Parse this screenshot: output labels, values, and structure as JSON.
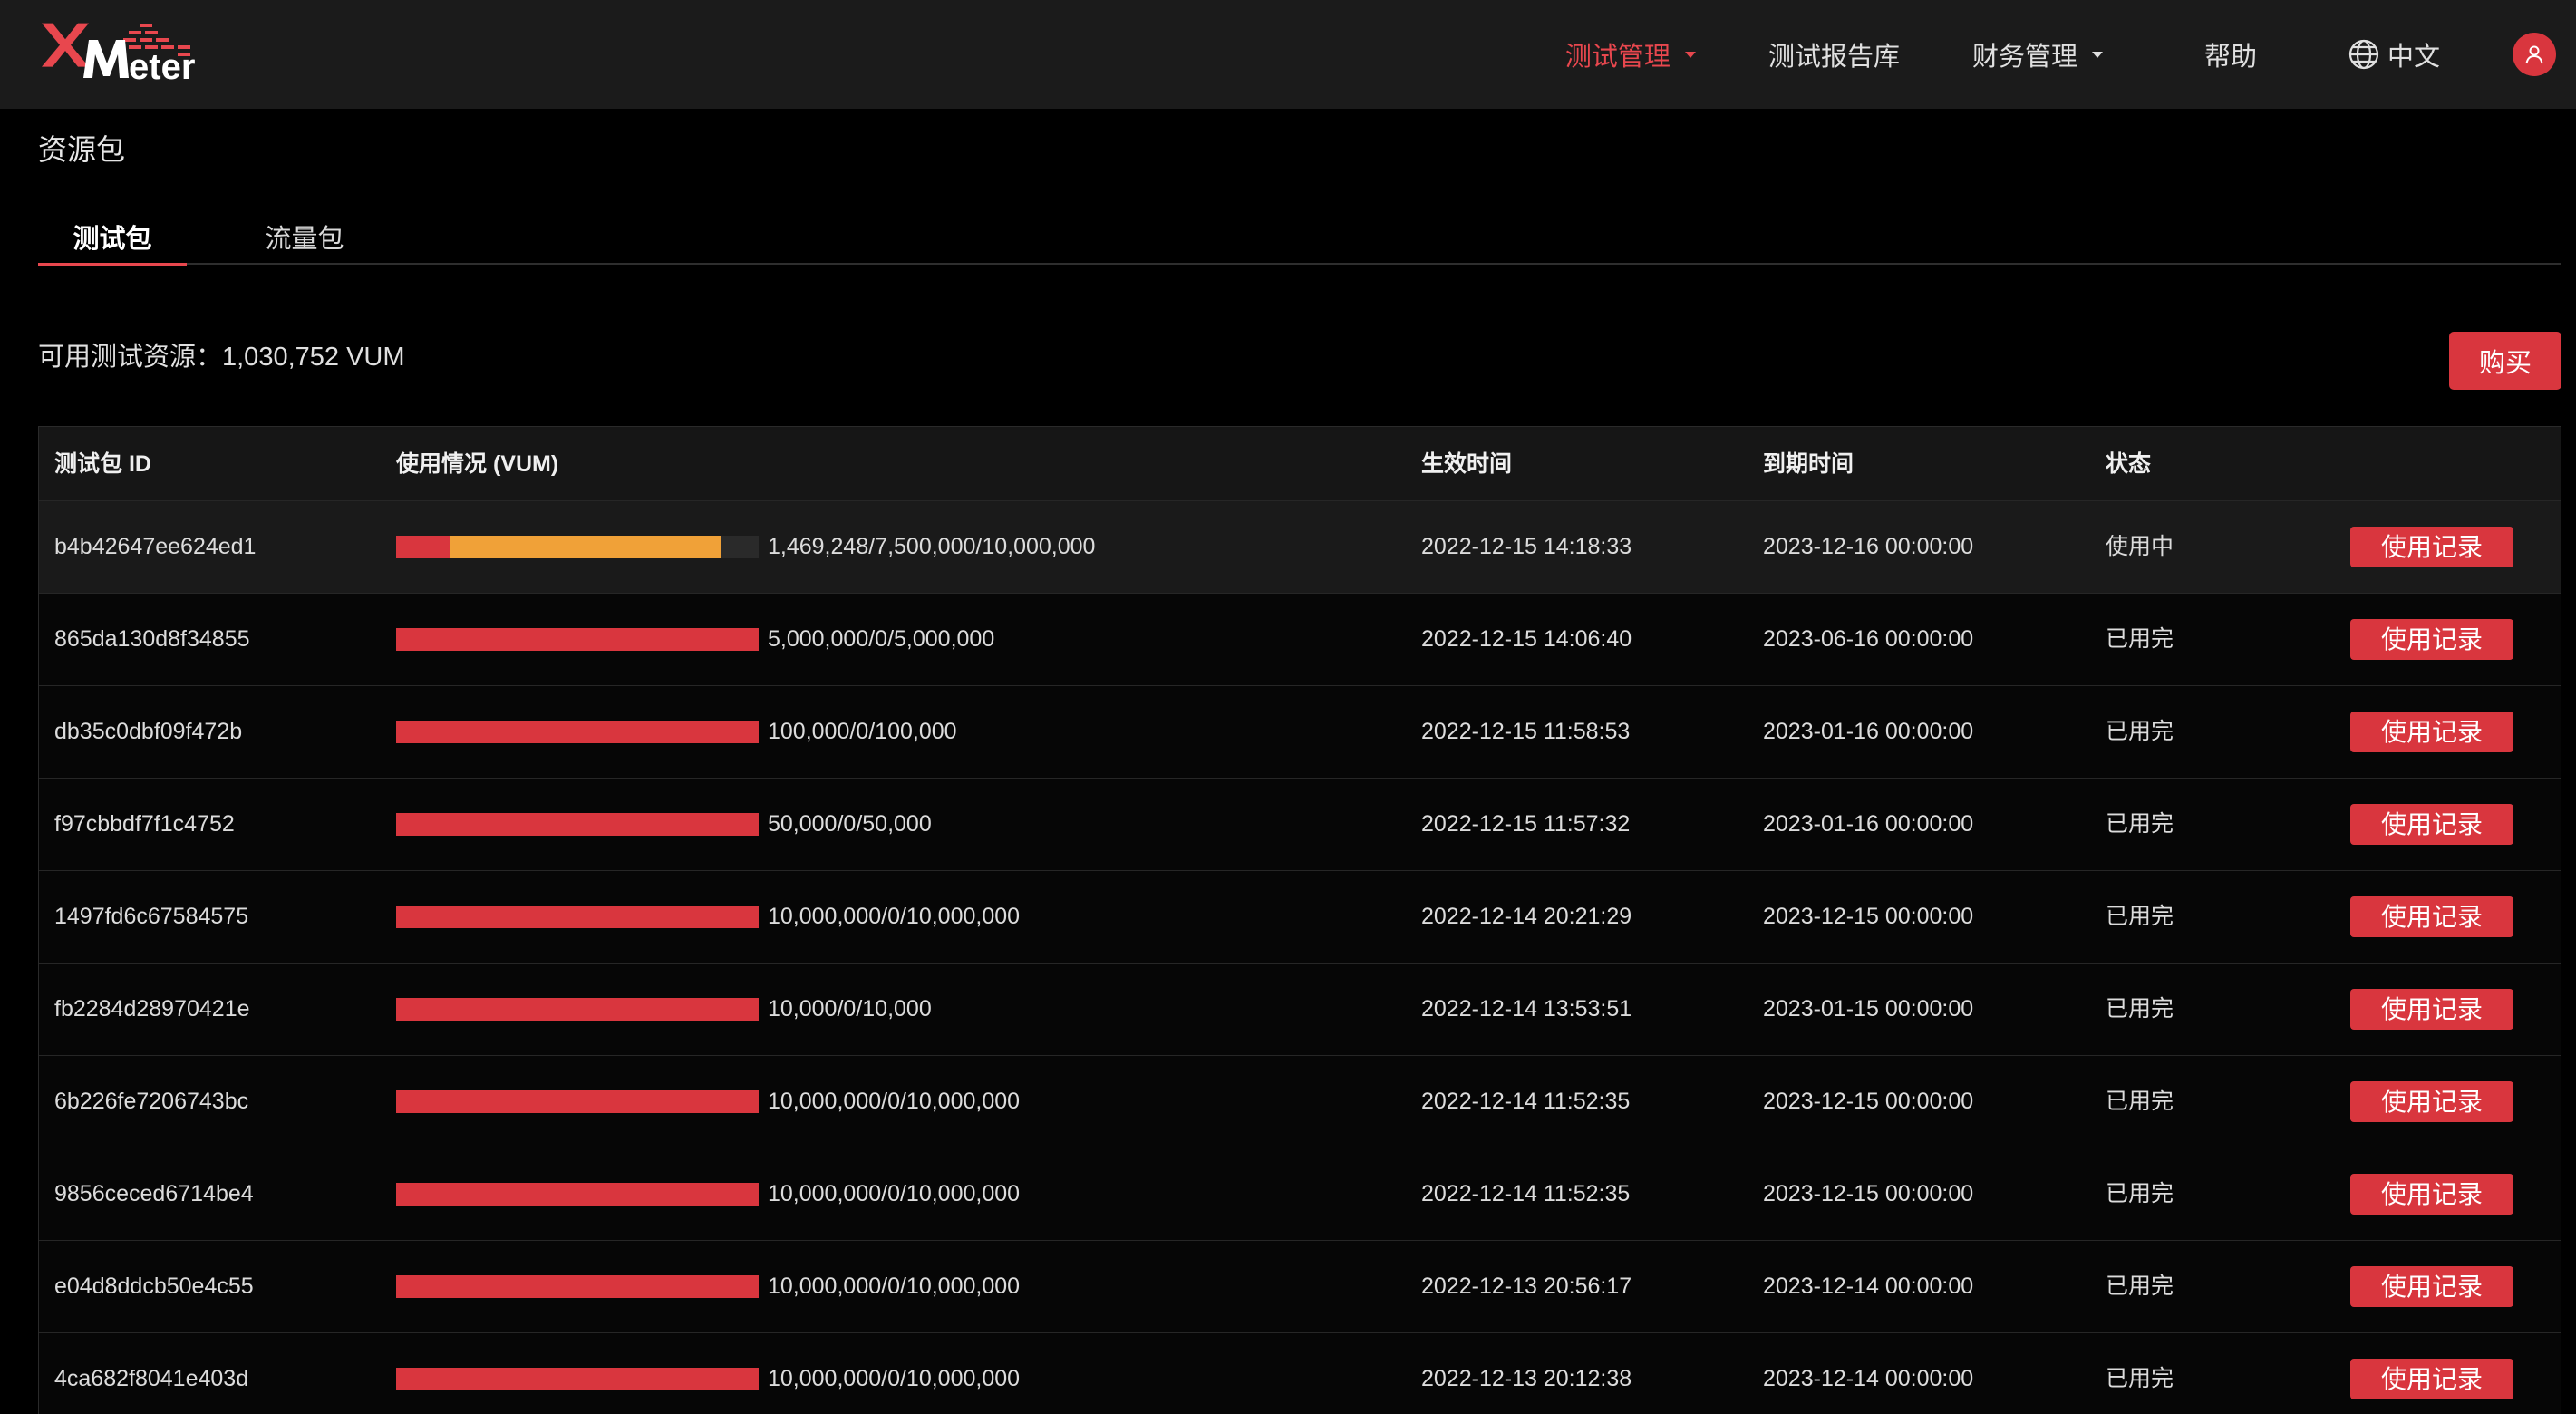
{
  "header": {
    "logo_text": "XMeter",
    "nav": [
      {
        "label": "测试管理",
        "active": true,
        "dropdown": true
      },
      {
        "label": "测试报告库",
        "active": false,
        "dropdown": false
      },
      {
        "label": "财务管理",
        "active": false,
        "dropdown": true
      },
      {
        "label": "帮助",
        "active": false,
        "dropdown": false
      }
    ],
    "language": "中文",
    "language_icon": "globe-icon",
    "avatar_icon": "user-icon"
  },
  "page": {
    "title": "资源包",
    "tabs": [
      {
        "label": "测试包",
        "active": true
      },
      {
        "label": "流量包",
        "active": false
      }
    ],
    "resource_label": "可用测试资源：1,030,752 VUM",
    "buy_label": "购买"
  },
  "table": {
    "columns": [
      "测试包 ID",
      "使用情况 (VUM)",
      "生效时间",
      "到期时间",
      "状态"
    ],
    "rows": [
      {
        "id": "b4b42647ee624ed1",
        "usage": "1,469,248/7,500,000/10,000,000",
        "used": 1469248,
        "available": 7500000,
        "total": 10000000,
        "start": "2022-12-15 14:18:33",
        "end": "2023-12-16 00:00:00",
        "status": "使用中",
        "action": "使用记录"
      },
      {
        "id": "865da130d8f34855",
        "usage": "5,000,000/0/5,000,000",
        "used": 5000000,
        "available": 0,
        "total": 5000000,
        "start": "2022-12-15 14:06:40",
        "end": "2023-06-16 00:00:00",
        "status": "已用完",
        "action": "使用记录"
      },
      {
        "id": "db35c0dbf09f472b",
        "usage": "100,000/0/100,000",
        "used": 100000,
        "available": 0,
        "total": 100000,
        "start": "2022-12-15 11:58:53",
        "end": "2023-01-16 00:00:00",
        "status": "已用完",
        "action": "使用记录"
      },
      {
        "id": "f97cbbdf7f1c4752",
        "usage": "50,000/0/50,000",
        "used": 50000,
        "available": 0,
        "total": 50000,
        "start": "2022-12-15 11:57:32",
        "end": "2023-01-16 00:00:00",
        "status": "已用完",
        "action": "使用记录"
      },
      {
        "id": "1497fd6c67584575",
        "usage": "10,000,000/0/10,000,000",
        "used": 10000000,
        "available": 0,
        "total": 10000000,
        "start": "2022-12-14 20:21:29",
        "end": "2023-12-15 00:00:00",
        "status": "已用完",
        "action": "使用记录"
      },
      {
        "id": "fb2284d28970421e",
        "usage": "10,000/0/10,000",
        "used": 10000,
        "available": 0,
        "total": 10000,
        "start": "2022-12-14 13:53:51",
        "end": "2023-01-15 00:00:00",
        "status": "已用完",
        "action": "使用记录"
      },
      {
        "id": "6b226fe7206743bc",
        "usage": "10,000,000/0/10,000,000",
        "used": 10000000,
        "available": 0,
        "total": 10000000,
        "start": "2022-12-14 11:52:35",
        "end": "2023-12-15 00:00:00",
        "status": "已用完",
        "action": "使用记录"
      },
      {
        "id": "9856ceced6714be4",
        "usage": "10,000,000/0/10,000,000",
        "used": 10000000,
        "available": 0,
        "total": 10000000,
        "start": "2022-12-14 11:52:35",
        "end": "2023-12-15 00:00:00",
        "status": "已用完",
        "action": "使用记录"
      },
      {
        "id": "e04d8ddcb50e4c55",
        "usage": "10,000,000/0/10,000,000",
        "used": 10000000,
        "available": 0,
        "total": 10000000,
        "start": "2022-12-13 20:56:17",
        "end": "2023-12-14 00:00:00",
        "status": "已用完",
        "action": "使用记录"
      },
      {
        "id": "4ca682f8041e403d",
        "usage": "10,000,000/0/10,000,000",
        "used": 10000000,
        "available": 0,
        "total": 10000000,
        "start": "2022-12-13 20:12:38",
        "end": "2023-12-14 00:00:00",
        "status": "已用完",
        "action": "使用记录"
      }
    ]
  },
  "colors": {
    "accent": "#d9363e",
    "available": "#f0a138",
    "background": "#000000",
    "topbar": "#1b1b1b"
  }
}
